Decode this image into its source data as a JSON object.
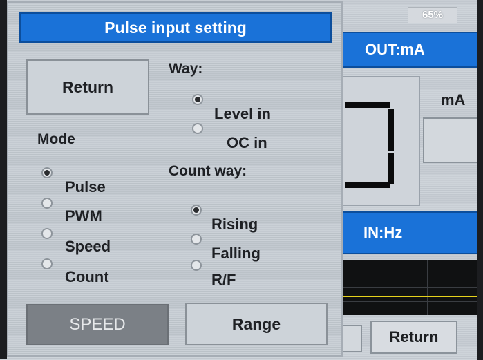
{
  "background": {
    "badge_text": "65%",
    "out_label": "OUT:mA",
    "unit_label": "mA",
    "in_label": "IN:Hz",
    "return_label": "Return"
  },
  "dialog": {
    "title": "Pulse input setting",
    "return_button": "Return",
    "mode": {
      "heading": "Mode",
      "options": [
        "Pulse",
        "PWM",
        "Speed",
        "Count"
      ],
      "selected": "Pulse"
    },
    "way": {
      "heading": "Way:",
      "options": [
        "Level in",
        "OC in"
      ],
      "selected": "Level in"
    },
    "count_way": {
      "heading": "Count way:",
      "options": [
        "Rising",
        "Falling",
        "R/F"
      ],
      "selected": "Rising"
    },
    "speed_button": "SPEED",
    "range_button": "Range"
  },
  "colors": {
    "accent": "#1a72d8",
    "panel": "#c5ccd3",
    "disabled_button": "#7b8086",
    "trace": "#e6d21c"
  }
}
